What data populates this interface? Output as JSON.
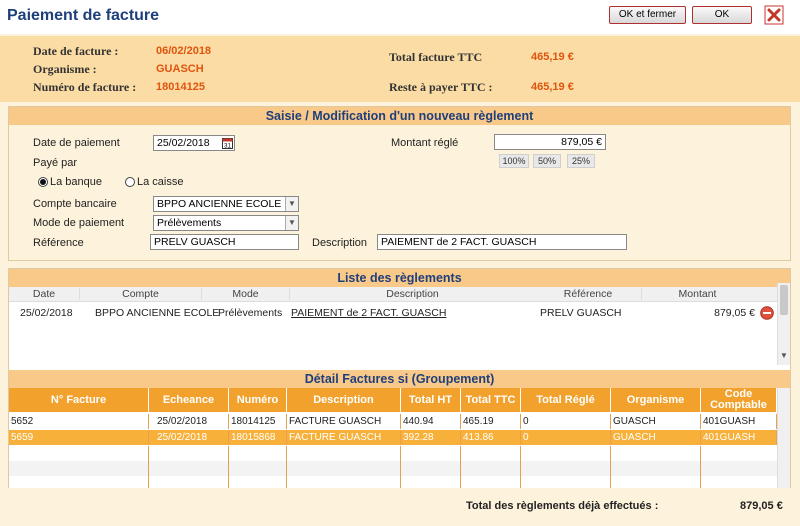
{
  "window": {
    "title": "Paiement de facture",
    "ok_close_label": "OK et fermer",
    "ok_label": "OK"
  },
  "summary": {
    "date_label": "Date de facture :",
    "date_value": "06/02/2018",
    "org_label": "Organisme :",
    "org_value": "GUASCH",
    "num_label": "Numéro de facture :",
    "num_value": "18014125",
    "total_label": "Total facture TTC",
    "total_value": "465,19 €",
    "rest_label": "Reste à payer TTC :",
    "rest_value": "465,19 €"
  },
  "form": {
    "section_title": "Saisie / Modification d'un nouveau règlement",
    "date_label": "Date de paiement",
    "date_value": "25/02/2018",
    "amount_label": "Montant réglé",
    "amount_value": "879,05 €",
    "pct_buttons": [
      "100%",
      "50%",
      "25%"
    ],
    "paid_by_label": "Payé par",
    "radio_bank": "La banque",
    "radio_cash": "La caisse",
    "account_label": "Compte bancaire",
    "account_value": "BPPO ANCIENNE ECOLE",
    "mode_label": "Mode de paiement",
    "mode_value": "Prélèvements",
    "ref_label": "Référence",
    "ref_value": "PRELV GUASCH",
    "desc_label": "Description",
    "desc_value": "PAIEMENT de 2 FACT. GUASCH"
  },
  "reglements": {
    "title": "Liste des règlements",
    "headers": [
      "Date",
      "Compte",
      "Mode",
      "Description",
      "Référence",
      "Montant"
    ],
    "rows": [
      {
        "date": "25/02/2018",
        "compte": "BPPO ANCIENNE ECOLE",
        "mode": "Prélèvements",
        "description": "PAIEMENT de 2 FACT. GUASCH",
        "reference": "PRELV GUASCH",
        "montant": "879,05 €"
      }
    ]
  },
  "details": {
    "title": "Détail Factures si (Groupement)",
    "headers": [
      "N° Facture",
      "Echeance",
      "Numéro",
      "Description",
      "Total HT",
      "Total TTC",
      "Total Réglé",
      "Organisme",
      "Code Comptable"
    ],
    "rows": [
      [
        "5652",
        "25/02/2018",
        "18014125",
        "FACTURE GUASCH",
        "440.94",
        "465.19",
        "0",
        "GUASCH",
        "401GUASH"
      ],
      [
        "5659",
        "25/02/2018",
        "18015868",
        "FACTURE GUASCH",
        "392.28",
        "413.86",
        "0",
        "GUASCH",
        "401GUASH"
      ]
    ]
  },
  "footer": {
    "label": "Total des règlements déjà effectués :",
    "value": "879,05 €"
  },
  "colors": {
    "accent_orange": "#f2a12c",
    "selected_row": "#f7b13a",
    "title_blue": "#1f3f7a",
    "value_orange": "#e0540e"
  }
}
